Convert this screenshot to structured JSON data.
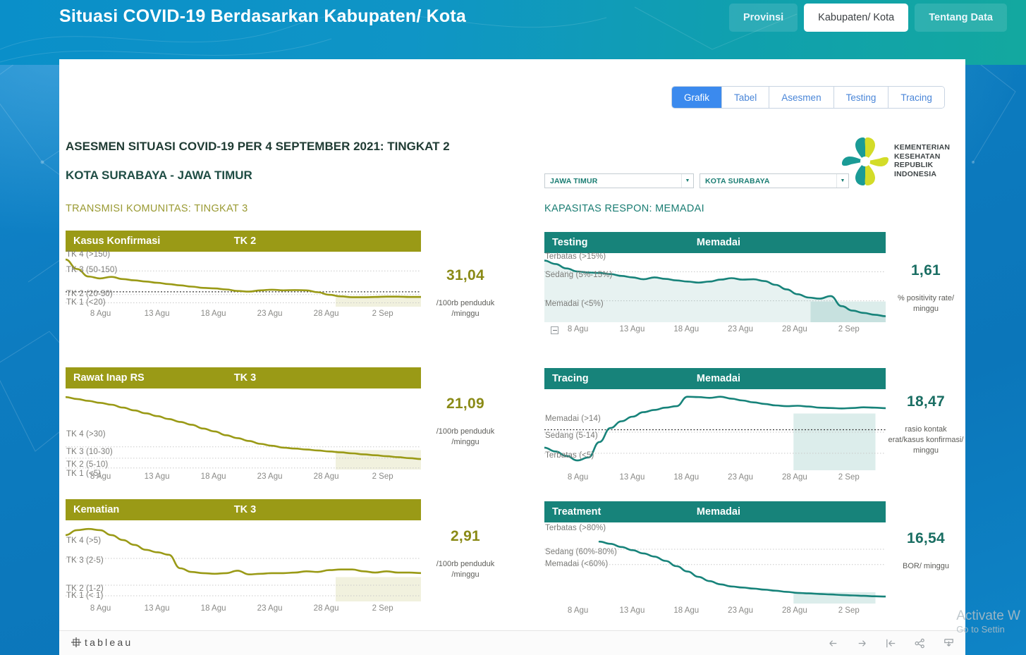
{
  "header": {
    "title": "Situasi COVID-19 Berdasarkan Kabupaten/ Kota",
    "nav": [
      {
        "label": "Provinsi",
        "active": false
      },
      {
        "label": "Kabupaten/ Kota",
        "active": true
      },
      {
        "label": "Tentang Data",
        "active": false
      }
    ]
  },
  "tabs": [
    {
      "label": "Grafik",
      "active": true
    },
    {
      "label": "Tabel",
      "active": false
    },
    {
      "label": "Asesmen",
      "active": false
    },
    {
      "label": "Testing",
      "active": false
    },
    {
      "label": "Tracing",
      "active": false
    }
  ],
  "titles": {
    "main": "ASESMEN SITUASI COVID-19 PER 4 SEPTEMBER 2021: TINGKAT 2",
    "sub": "KOTA SURABAYA - JAWA TIMUR",
    "left_column": "TRANSMISI KOMUNITAS: TINGKAT 3",
    "right_column": "KAPASITAS RESPON: MEMADAI"
  },
  "filters": {
    "province": {
      "value": "JAWA TIMUR",
      "placeholder": "JAWA TIMUR"
    },
    "city": {
      "value": "KOTA SURABAYA",
      "placeholder": "KOTA SURABAYA"
    }
  },
  "logo": {
    "line1": "KEMENTERIAN",
    "line2": "KESEHATAN",
    "line3": "REPUBLIK",
    "line4": "INDONESIA",
    "color_teal": "#1a9b96",
    "color_lime": "#d3dc28"
  },
  "colors": {
    "olive": "#9a9a16",
    "teal": "#17837a",
    "accent_blue": "#3b8aee"
  },
  "toolbar": {
    "brand": "tableau",
    "icons": [
      "back-arrow-icon",
      "forward-arrow-icon",
      "revert-icon",
      "share-icon",
      "download-icon"
    ]
  },
  "watermark": {
    "line1": "Activate W",
    "line2": "Go to Settin"
  },
  "chart_data": [
    {
      "id": "kasus-konfirmasi",
      "type": "line",
      "title": "Kasus Konfirmasi",
      "level": "TK  2",
      "color": "#9a9a16",
      "value": "31,04",
      "unit": "/100rb penduduk /minggu",
      "ylabel_bands": [
        "TK 4 (>150)",
        "TK 3 (50-150)",
        "TK 2 (20-50)",
        "TK 1 (<20)"
      ],
      "xtick_labels": [
        "8 Agu",
        "13 Agu",
        "18 Agu",
        "23 Agu",
        "28 Agu",
        "2 Sep"
      ],
      "values": [
        150,
        120,
        96,
        90,
        95,
        88,
        84,
        80,
        76,
        72,
        68,
        64,
        60,
        58,
        55,
        50,
        48,
        52,
        54,
        52,
        53,
        52,
        46,
        38,
        33,
        30,
        30,
        31,
        32,
        32,
        31,
        31
      ]
    },
    {
      "id": "rawat-inap-rs",
      "type": "line",
      "title": "Rawat Inap RS",
      "level": "TK  3",
      "color": "#9a9a16",
      "value": "21,09",
      "unit": "/100rb penduduk /minggu",
      "ylabel_bands": [
        "TK 4 (>30)",
        "TK 3 (10-30)",
        "TK 2 (5-10)",
        "TK 1 (<5)"
      ],
      "xtick_labels": [
        "8 Agu",
        "13 Agu",
        "18 Agu",
        "23 Agu",
        "28 Agu",
        "2 Sep"
      ],
      "values": [
        86,
        84,
        82,
        80,
        78,
        75,
        72,
        69,
        66,
        63,
        60,
        57,
        53,
        50,
        46,
        43,
        40,
        37,
        35,
        33,
        32,
        31,
        30,
        29,
        28,
        27,
        26,
        25,
        24,
        23,
        22,
        21
      ]
    },
    {
      "id": "kematian",
      "type": "line",
      "title": "Kematian",
      "level": "TK  3",
      "color": "#9a9a16",
      "value": "2,91",
      "unit": "/100rb penduduk /minggu",
      "ylabel_bands": [
        "TK 4 (>5)",
        "TK 3 (2-5)",
        "TK 2 (1-2)",
        "TK 1 (< 1)"
      ],
      "xtick_labels": [
        "8 Agu",
        "13 Agu",
        "18 Agu",
        "23 Agu",
        "28 Agu",
        "2 Sep"
      ],
      "values": [
        6.0,
        6.4,
        6.5,
        6.4,
        6.0,
        5.6,
        5.2,
        4.8,
        4.6,
        4.4,
        3.3,
        3.0,
        2.9,
        2.85,
        2.9,
        3.1,
        2.8,
        2.85,
        2.9,
        2.9,
        2.95,
        3.05,
        3.0,
        3.15,
        3.2,
        3.2,
        3.05,
        2.95,
        3.05,
        2.95,
        2.95,
        2.91
      ]
    },
    {
      "id": "testing",
      "type": "line",
      "title": "Testing",
      "level": "Memadai",
      "color": "#17837a",
      "value": "1,61",
      "unit": "% positivity rate/ minggu",
      "ylabel_bands": [
        "Terbatas (>15%)",
        "Sedang (5%-15%)",
        "Memadai (<5%)"
      ],
      "xtick_labels": [
        "8 Agu",
        "13 Agu",
        "18 Agu",
        "23 Agu",
        "28 Agu",
        "2 Sep"
      ],
      "values": [
        16.5,
        15.6,
        14.4,
        13.6,
        13.3,
        13.2,
        12.9,
        12.4,
        12.0,
        11.5,
        12.0,
        11.6,
        11.2,
        10.9,
        10.6,
        10.9,
        11.4,
        11.8,
        11.4,
        11.5,
        11.0,
        10.0,
        8.8,
        7.5,
        6.6,
        6.3,
        7.0,
        4.3,
        3.1,
        2.5,
        2.0,
        1.61
      ]
    },
    {
      "id": "tracing",
      "type": "line",
      "title": "Tracing",
      "level": "Memadai",
      "color": "#17837a",
      "value": "18,47",
      "unit": "rasio kontak erat/kasus konfirmasi/ minggu",
      "ylabel_bands": [
        "Memadai (>14)",
        "Sedang (5-14)",
        "Terbatas (<5)"
      ],
      "xtick_labels": [
        "8 Agu",
        "13 Agu",
        "18 Agu",
        "23 Agu",
        "28 Agu",
        "2 Sep"
      ],
      "values": [
        8.0,
        7.0,
        5.8,
        4.6,
        5.4,
        9.5,
        13.2,
        15.0,
        16.2,
        17.4,
        18.0,
        18.6,
        19.0,
        21.5,
        21.4,
        21.2,
        21.5,
        21.0,
        20.5,
        20.0,
        19.6,
        19.2,
        19.0,
        19.1,
        18.9,
        18.6,
        18.5,
        18.4,
        18.5,
        18.7,
        18.6,
        18.47
      ]
    },
    {
      "id": "treatment",
      "type": "line",
      "title": "Treatment",
      "level": "Memadai",
      "color": "#17837a",
      "value": "16,54",
      "unit": "BOR/ minggu",
      "ylabel_bands": [
        "Terbatas (>80%)",
        "Sedang (60%-80%)",
        "Memadai (<60%)"
      ],
      "xtick_labels": [
        "8 Agu",
        "13 Agu",
        "18 Agu",
        "23 Agu",
        "28 Agu",
        "2 Sep"
      ],
      "values": [
        null,
        null,
        null,
        null,
        null,
        68,
        66,
        63,
        60,
        57,
        54,
        50,
        45,
        40,
        35,
        31,
        28,
        26,
        25,
        24,
        23,
        22,
        21,
        20,
        19.5,
        19,
        18.5,
        18,
        17.6,
        17.2,
        16.8,
        16.54
      ]
    }
  ]
}
